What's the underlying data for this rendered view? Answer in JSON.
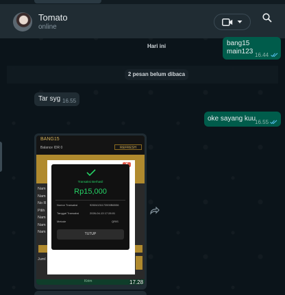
{
  "header": {
    "contact_name": "Tomato",
    "contact_status": "online"
  },
  "icons": {
    "video": "video-camera-icon",
    "dropdown": "chevron-down-icon",
    "search": "search-icon",
    "forward": "forward-icon"
  },
  "messages": {
    "outgoing_1": {
      "line1": "bang15",
      "line2": "main123",
      "time": "16.44"
    },
    "date_divider": "Hari ini",
    "unread_divider": "2 pesan belum dibaca",
    "incoming_1": {
      "text": "Tar syg",
      "time": "16.55"
    },
    "outgoing_2": {
      "text": "oke sayang kuu",
      "time": "16.55"
    },
    "image_message": {
      "time": "17.28"
    }
  },
  "screenshot": {
    "app_title": "BANG15",
    "balance": "Balance  IDR  0",
    "refresh": "REFRESH",
    "popup_title": "Transaksi Berhasil",
    "amount": "Rp15,000",
    "row1_label": "Nomor Transaksi",
    "row1_value": "92604131172000B6536",
    "row2_label": "Tanggal Transaksi",
    "row2_value": "2026-04-13 17:28:01",
    "row3_label": "Metode",
    "row3_value": "QRIS",
    "close_button": "TUTUP",
    "bottom_button": "Kirim",
    "left_labels": [
      "Nam",
      "Nam",
      "No R",
      "Pilih",
      "Nam",
      "Nam",
      "Nam"
    ],
    "jumlah": "Juml"
  },
  "colors": {
    "header_bg": "#202c33",
    "chat_bg": "#0b141a",
    "outgoing_bubble": "#005c4b",
    "incoming_bubble": "#202c33",
    "read_ticks": "#53bdeb",
    "gold_accent": "#b08a2e",
    "success_green": "#25d366"
  }
}
